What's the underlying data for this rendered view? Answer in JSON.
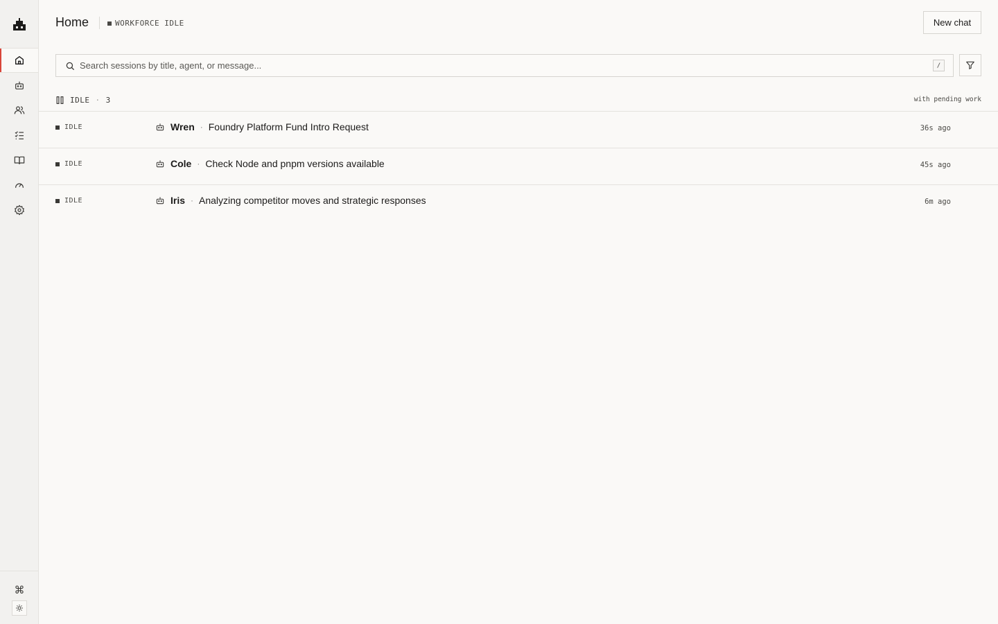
{
  "sidebar": {
    "logo_icon": "robot-logo-icon",
    "items": [
      {
        "name": "home",
        "icon": "home-icon",
        "active": true
      },
      {
        "name": "agents",
        "icon": "robot-icon",
        "active": false
      },
      {
        "name": "people",
        "icon": "users-icon",
        "active": false
      },
      {
        "name": "tasks",
        "icon": "checklist-icon",
        "active": false
      },
      {
        "name": "library",
        "icon": "book-icon",
        "active": false
      },
      {
        "name": "usage",
        "icon": "gauge-icon",
        "active": false
      },
      {
        "name": "settings",
        "icon": "gear-icon",
        "active": false
      }
    ],
    "command_glyph": "⌘",
    "theme_icon": "sun-icon"
  },
  "header": {
    "title": "Home",
    "workforce_status": "WORKFORCE IDLE",
    "new_chat_label": "New chat"
  },
  "search": {
    "placeholder": "Search sessions by title, agent, or message...",
    "value": "",
    "shortcut": "/",
    "filter_icon": "filter-icon"
  },
  "group": {
    "label": "IDLE",
    "count": "3",
    "note": "with pending work"
  },
  "sessions": [
    {
      "status": "IDLE",
      "agent": "Wren",
      "title": "Foundry Platform Fund Intro Request",
      "time": "36s ago"
    },
    {
      "status": "IDLE",
      "agent": "Cole",
      "title": "Check Node and pnpm versions available",
      "time": "45s ago"
    },
    {
      "status": "IDLE",
      "agent": "Iris",
      "title": "Analyzing competitor moves and strategic responses",
      "time": "6m ago"
    }
  ],
  "colors": {
    "accent": "#d9453a",
    "background": "#faf9f7",
    "sidebar": "#f2f1ef"
  }
}
